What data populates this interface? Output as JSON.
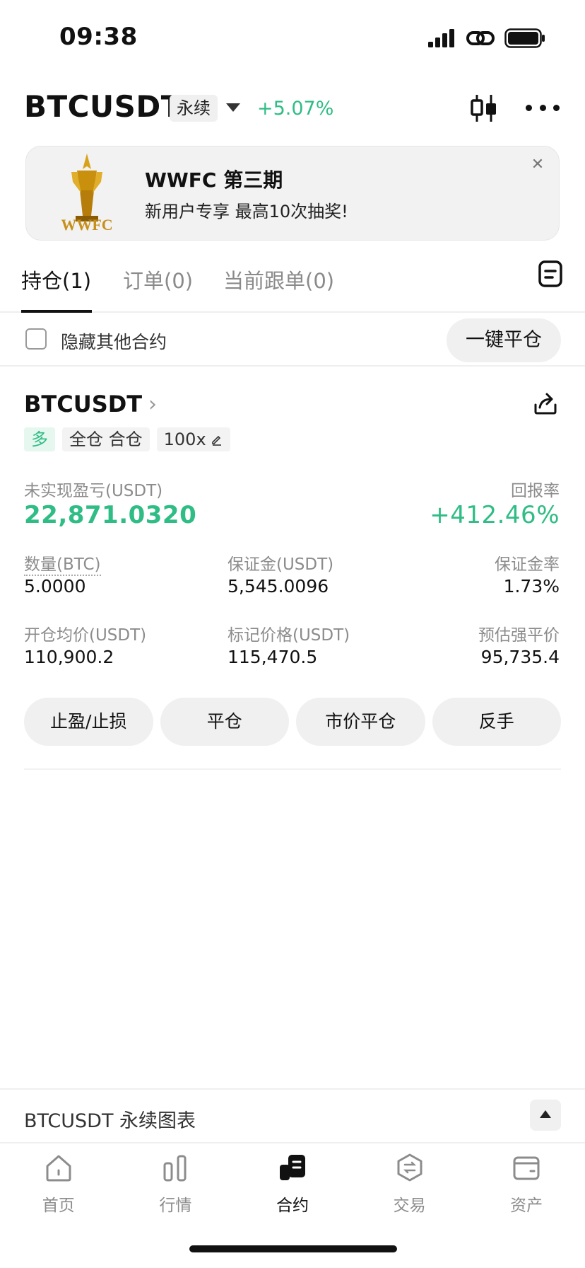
{
  "status_bar": {
    "time": "09:38"
  },
  "header": {
    "symbol": "BTCUSDT",
    "contract_tag": "永续",
    "change": "+5.07%"
  },
  "banner": {
    "title": "WWFC 第三期",
    "subtitle": "新用户专享 最高10次抽奖!",
    "logo_text": "WWFC"
  },
  "tabs": [
    {
      "label": "持仓(1)",
      "active": true
    },
    {
      "label": "订单(0)",
      "active": false
    },
    {
      "label": "当前跟单(0)",
      "active": false
    }
  ],
  "filter": {
    "hide_label": "隐藏其他合约",
    "close_all": "一键平仓"
  },
  "position": {
    "symbol": "BTCUSDT",
    "badges": {
      "side": "多",
      "mode": "全仓 合仓",
      "leverage": "100x"
    },
    "pnl_label": "未实现盈亏(USDT)",
    "pnl_value": "22,871.0320",
    "roe_label": "回报率",
    "roe_value": "+412.46%",
    "fields": {
      "qty_label": "数量(BTC)",
      "qty_value": "5.0000",
      "margin_label": "保证金(USDT)",
      "margin_value": "5,545.0096",
      "margin_ratio_label": "保证金率",
      "margin_ratio_value": "1.73%",
      "entry_label": "开仓均价(USDT)",
      "entry_value": "110,900.2",
      "mark_label": "标记价格(USDT)",
      "mark_value": "115,470.5",
      "liq_label": "预估强平价",
      "liq_value": "95,735.4"
    },
    "actions": [
      "止盈/止损",
      "平仓",
      "市价平仓",
      "反手"
    ]
  },
  "chart_bar": {
    "label": "BTCUSDT 永续图表"
  },
  "tabbar": [
    {
      "label": "首页",
      "icon": "home-icon",
      "active": false
    },
    {
      "label": "行情",
      "icon": "market-icon",
      "active": false
    },
    {
      "label": "合约",
      "icon": "futures-icon",
      "active": true
    },
    {
      "label": "交易",
      "icon": "trade-icon",
      "active": false
    },
    {
      "label": "资产",
      "icon": "wallet-icon",
      "active": false
    }
  ],
  "colors": {
    "green": "#2fbd85",
    "text": "#111111",
    "muted": "#8c8c8c",
    "chip": "#f0f0f0"
  }
}
